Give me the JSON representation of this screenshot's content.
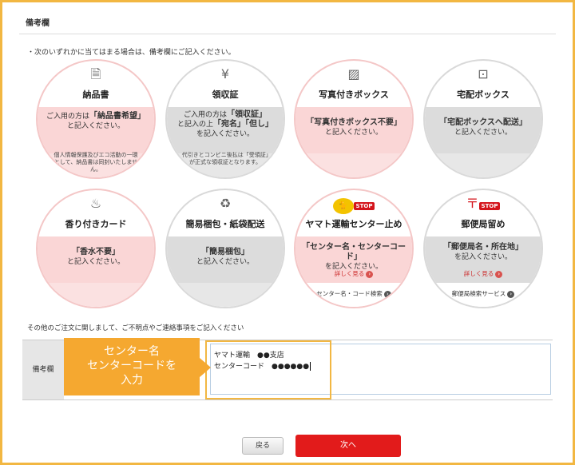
{
  "section_title": "備考欄",
  "note": "・次のいずれかに当てはまる場合は、備考欄にご記入ください。",
  "options": [
    {
      "title": "納品書",
      "icon": "document-icon",
      "band_pre": "ご入用の方は",
      "band_em": "「納品書希望」",
      "band_post": "と記入ください。",
      "sub": "個人情報保護及びエコ活動の一環として、納品書は同封いたしません。"
    },
    {
      "title": "領収証",
      "icon": "receipt-icon",
      "band_pre": "ご入用の方は",
      "band_em": "「領収証」",
      "band_mid": "と記入の上",
      "band_em2": "「宛名」「但し」",
      "band_post": "を記入ください。",
      "sub": "代引きとコンビニ後払は「受領証」が正式な領収証となります。"
    },
    {
      "title": "写真付きボックス",
      "icon": "photo-box-icon",
      "band_em": "「写真付きボックス不要」",
      "band_post": "と記入ください。"
    },
    {
      "title": "宅配ボックス",
      "icon": "delivery-box-icon",
      "band_em": "「宅配ボックスへ配送」",
      "band_post": "と記入ください。"
    },
    {
      "title": "香り付きカード",
      "icon": "perfume-icon",
      "band_em": "「香水不要」",
      "band_post": "と記入ください。"
    },
    {
      "title": "簡易梱包・紙袋配送",
      "icon": "recycle-bag-icon",
      "band_em": "「簡易梱包」",
      "band_post": "と記入ください。"
    },
    {
      "title": "ヤマト運輸センター止め",
      "icon": "yamato-stop-icon",
      "band_em": "「センター名・センターコード」",
      "band_post": "を記入ください。",
      "detail_link": "詳しく見る",
      "search_link": "センター名・コード検索"
    },
    {
      "title": "郵便局留め",
      "icon": "post-stop-icon",
      "band_em": "「郵便局名・所在地」",
      "band_post": "を記入ください。",
      "detail_link": "詳しく見る",
      "search_link": "郵便局検索サービス"
    }
  ],
  "stop_label": "STOP",
  "inquiry_text": "その他のご注文に関しまして、ご不明点やご連絡事項をご記入ください",
  "remarks": {
    "label": "備考欄",
    "line1": "ヤマト運輸　●●支店",
    "line2": "センターコード　●●●●●●"
  },
  "callout": {
    "line1": "センター名",
    "line2": "センターコードを",
    "line3": "入力"
  },
  "buttons": {
    "back": "戻る",
    "next": "次へ"
  },
  "colors": {
    "accent_orange": "#f5a830",
    "frame": "#f2b742",
    "next_button": "#e21b1b",
    "pink_band": "#fad6d6",
    "gray_band": "#dcdcdc"
  }
}
